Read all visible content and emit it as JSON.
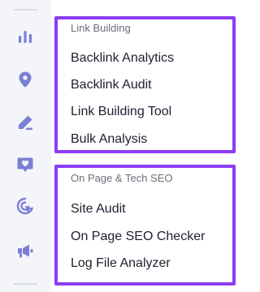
{
  "rail": {
    "icons": [
      "bar-chart-icon",
      "location-pin-icon",
      "pencil-icon",
      "heart-chat-icon",
      "target-cursor-icon",
      "megaphone-icon"
    ]
  },
  "sections": [
    {
      "title": "Link Building",
      "items": [
        "Backlink Analytics",
        "Backlink Audit",
        "Link Building Tool",
        "Bulk Analysis"
      ]
    },
    {
      "title": "On Page & Tech SEO",
      "items": [
        "Site Audit",
        "On Page SEO Checker",
        "Log File Analyzer"
      ]
    }
  ],
  "colors": {
    "accent_border": "#8d3cf5",
    "rail_icon": "#7b7fd4",
    "rail_bg": "#f4f5f9"
  }
}
